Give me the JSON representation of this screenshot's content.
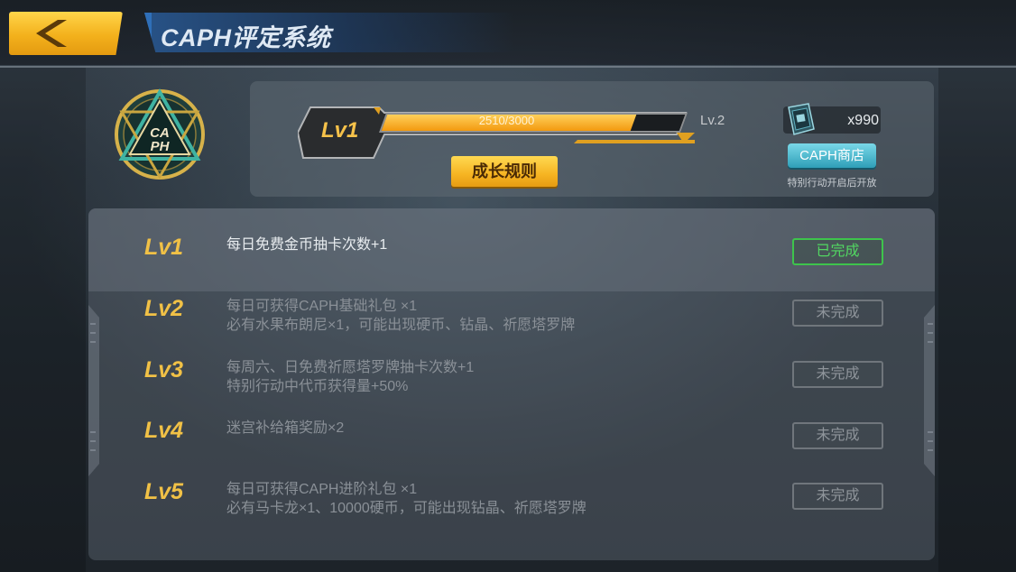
{
  "header": {
    "title": "CAPH评定系统",
    "back_label": "back"
  },
  "emblem": {
    "text": "CAPH"
  },
  "level": {
    "current_label": "Lv1",
    "progress_text": "2510/3000",
    "progress_value": 2510,
    "progress_max": 3000,
    "next_label": "Lv.2",
    "rules_button": "成长规则"
  },
  "currency": {
    "count": "x990",
    "shop_button": "CAPH商店",
    "shop_note": "特别行动开启后开放"
  },
  "levels": [
    {
      "lv": "Lv1",
      "line1": "每日免费金币抽卡次数+1",
      "line2": "",
      "status": "已完成",
      "done": true
    },
    {
      "lv": "Lv2",
      "line1": "每日可获得CAPH基础礼包 ×1",
      "line2": "必有水果布朗尼×1，可能出现硬币、钻晶、祈愿塔罗牌",
      "status": "未完成",
      "done": false
    },
    {
      "lv": "Lv3",
      "line1": "每周六、日免费祈愿塔罗牌抽卡次数+1",
      "line2": "特别行动中代币获得量+50%",
      "status": "未完成",
      "done": false
    },
    {
      "lv": "Lv4",
      "line1": "迷宫补给箱奖励×2",
      "line2": "",
      "status": "未完成",
      "done": false
    },
    {
      "lv": "Lv5",
      "line1": "每日可获得CAPH进阶礼包 ×1",
      "line2": "必有马卡龙×1、10000硬币，可能出现钻晶、祈愿塔罗牌",
      "status": "未完成",
      "done": false
    }
  ],
  "colors": {
    "accent_gold": "#f1c146",
    "done_green": "#52d862",
    "shop_cyan": "#2f9fb8"
  }
}
